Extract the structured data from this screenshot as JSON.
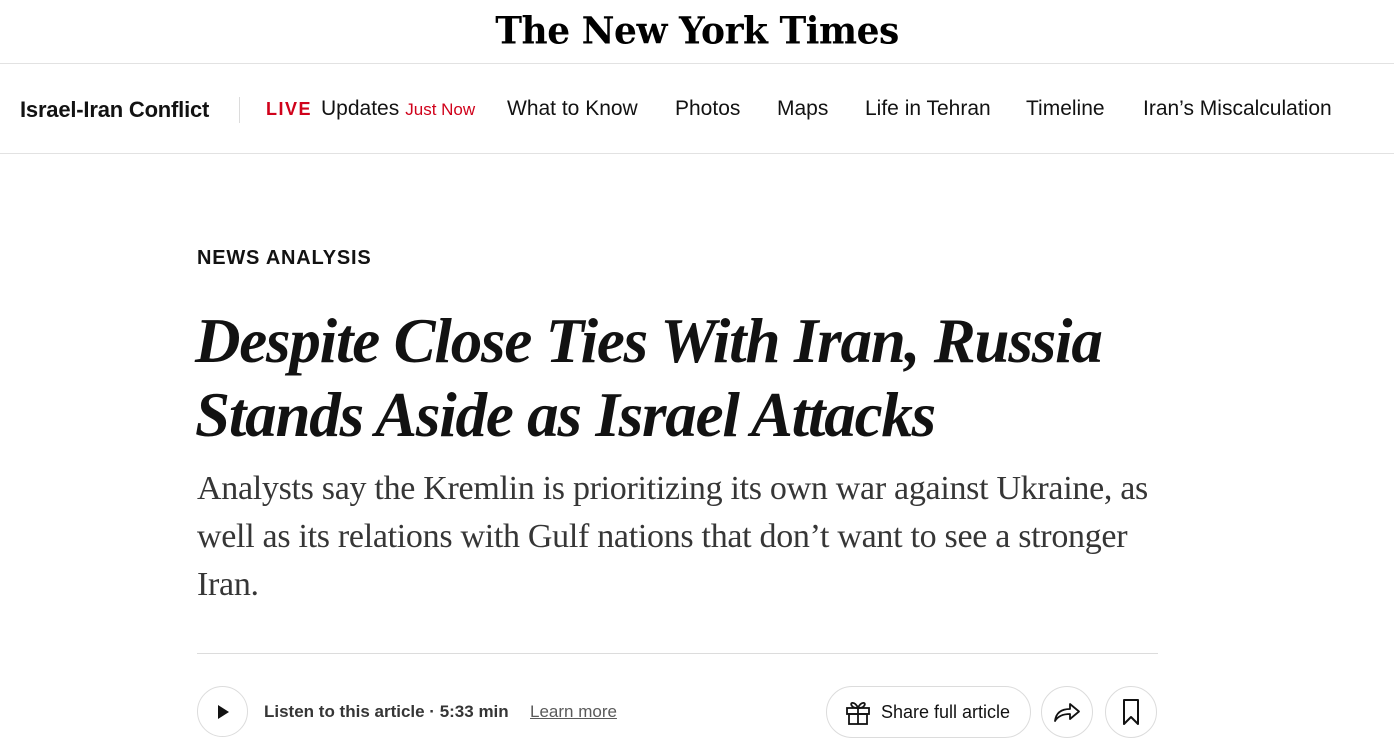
{
  "masthead": {
    "logo": "The New York Times"
  },
  "section_nav": {
    "section_title": "Israel-Iran Conflict",
    "live": {
      "badge": "LIVE",
      "label": "Updates",
      "time": "Just Now"
    },
    "items": [
      "What to Know",
      "Photos",
      "Maps",
      "Life in Tehran",
      "Timeline",
      "Iran’s Miscalculation"
    ]
  },
  "article": {
    "kicker": "NEWS ANALYSIS",
    "headline": "Despite Close Ties With Iran, Russia Stands Aside as Israel Attacks",
    "summary": "Analysts say the Kremlin is prioritizing its own war against Ukraine, as well as its relations with Gulf nations that don’t want to see a stronger Iran."
  },
  "toolbar": {
    "listen_text": "Listen to this article · 5:33 min",
    "learn_more": "Learn more",
    "share_label": "Share full article",
    "icons": {
      "play": "play-icon",
      "gift": "gift-icon",
      "forward": "share-arrow-icon",
      "bookmark": "bookmark-icon"
    }
  },
  "colors": {
    "live_red": "#d0021b",
    "text": "#121212",
    "summary_text": "#363636",
    "border": "#dcdcdc"
  }
}
